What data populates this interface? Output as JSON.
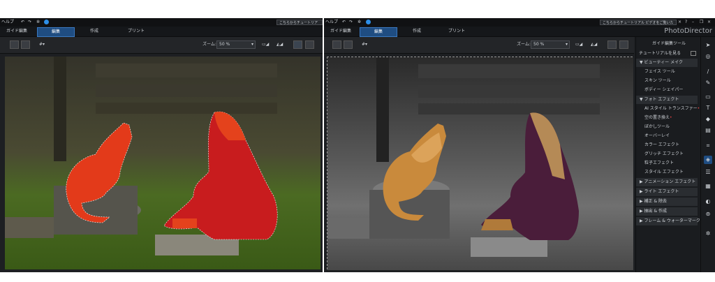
{
  "left": {
    "topbar": {
      "title_fragment": "ヘルプ",
      "tip": "こちらからチュートリアル ビデオをご覧"
    },
    "menu": [
      {
        "label": "ガイド編集",
        "active": false
      },
      {
        "label": "編集",
        "active": true
      },
      {
        "label": "作成",
        "active": false
      },
      {
        "label": "プリント",
        "active": false
      }
    ],
    "zoom_label": "ズーム:",
    "zoom_value": "50 %"
  },
  "right": {
    "topbar": {
      "title_fragment": "ヘルプ",
      "tip": "こちらからチュートリアル ビデオをご覧いただけます。"
    },
    "app_name": "PhotoDirector",
    "menu": [
      {
        "label": "ガイド編集",
        "active": false
      },
      {
        "label": "編集",
        "active": true
      },
      {
        "label": "作成",
        "active": false
      },
      {
        "label": "プリント",
        "active": false
      }
    ],
    "zoom_label": "ズーム:",
    "zoom_value": "50 %",
    "sidebar": {
      "title": "ガイド編集ツール",
      "tutorial_link": "チュートリアルを見る",
      "rows": [
        {
          "label": "▼ ビューティー メイク",
          "header": true
        },
        {
          "label": "フェイス ツール",
          "header": false
        },
        {
          "label": "スキン ツール",
          "header": false
        },
        {
          "label": "ボディー シェイパー",
          "header": false
        },
        {
          "label": "▼ フォト エフェクト",
          "header": true
        },
        {
          "label": "AI スタイル トランスファー",
          "header": false,
          "dot": true
        },
        {
          "label": "空の置き換え",
          "header": false,
          "dot": true
        },
        {
          "label": "ぼかしツール",
          "header": false
        },
        {
          "label": "オーバーレイ",
          "header": false
        },
        {
          "label": "カラー エフェクト",
          "header": false
        },
        {
          "label": "グリッチ エフェクト",
          "header": false
        },
        {
          "label": "粒子エフェクト",
          "header": false
        },
        {
          "label": "スタイル エフェクト",
          "header": false
        },
        {
          "label": "▶ アニメーション エフェクト",
          "header": true
        },
        {
          "label": "▶ ライト エフェクト",
          "header": true
        },
        {
          "label": "▶ 補正 & 除去",
          "header": true
        },
        {
          "label": "▶ 抽出 & 作成",
          "header": true
        },
        {
          "label": "▶ フレーム & ウォーターマーク",
          "header": true
        }
      ]
    }
  }
}
